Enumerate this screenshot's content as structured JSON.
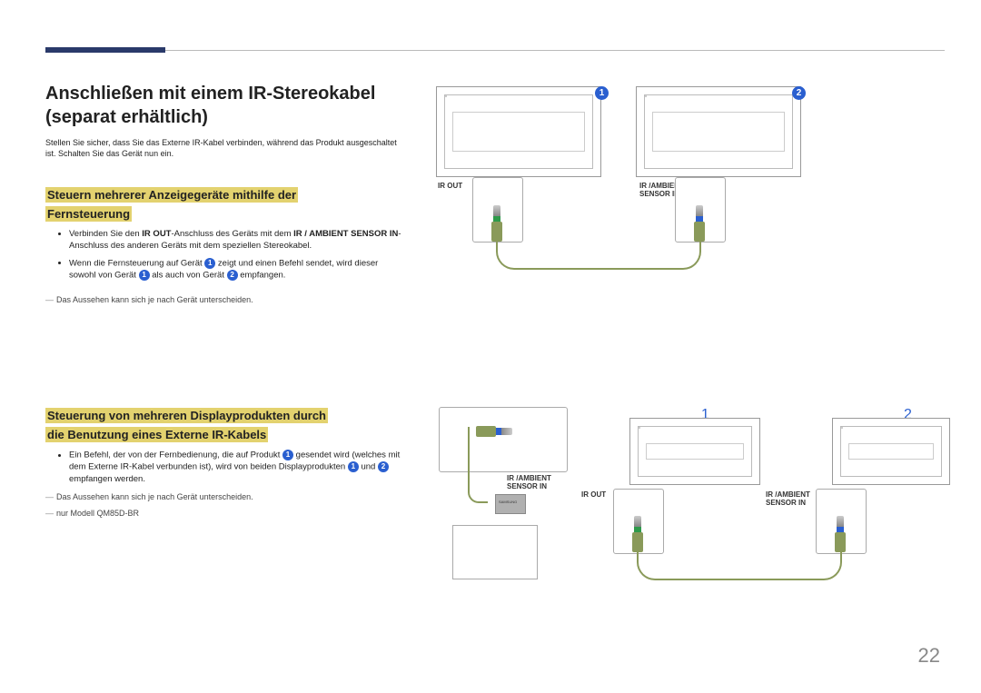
{
  "title": "Anschließen mit einem IR-Stereokabel (separat erhältlich)",
  "intro": "Stellen Sie sicher, dass Sie das Externe IR-Kabel verbinden, während das Produkt ausgeschaltet ist. Schalten Sie das Gerät nun ein.",
  "section1": {
    "heading_line1": "Steuern mehrerer Anzeigegeräte mithilfe der",
    "heading_line2": "Fernsteuerung",
    "bullet1_a": "Verbinden Sie den ",
    "bullet1_irout": "IR OUT",
    "bullet1_b": "-Anschluss des Geräts mit dem ",
    "bullet1_irin": "IR / AMBIENT SENSOR IN",
    "bullet1_c": "-Anschluss des anderen Geräts mit dem speziellen Stereokabel.",
    "bullet2_a": "Wenn die Fernsteuerung auf Gerät ",
    "bullet2_b": " zeigt und einen Befehl sendet, wird dieser sowohl von Gerät ",
    "bullet2_c": " als auch von Gerät ",
    "bullet2_d": " empfangen.",
    "note": "Das Aussehen kann sich je nach Gerät unterscheiden."
  },
  "section2": {
    "heading_line1": "Steuerung von mehreren Displayprodukten durch",
    "heading_line2": "die Benutzung eines Externe IR-Kabels",
    "bullet1_a": "Ein Befehl, der von der Fernbedienung, die auf Produkt ",
    "bullet1_b": " gesendet wird (welches mit dem Externe IR-Kabel verbunden ist), wird von beiden Displayprodukten ",
    "bullet1_c": " und ",
    "bullet1_d": " empfangen werden.",
    "note1": "Das Aussehen kann sich je nach Gerät unterscheiden.",
    "note2": "nur Modell QM85D-BR"
  },
  "labels": {
    "ir_out": "IR OUT",
    "ir_in": "IR /AMBIENT SENSOR IN",
    "samsung": "SAMSUNG"
  },
  "badges": {
    "one": "1",
    "two": "2"
  },
  "page": "22"
}
